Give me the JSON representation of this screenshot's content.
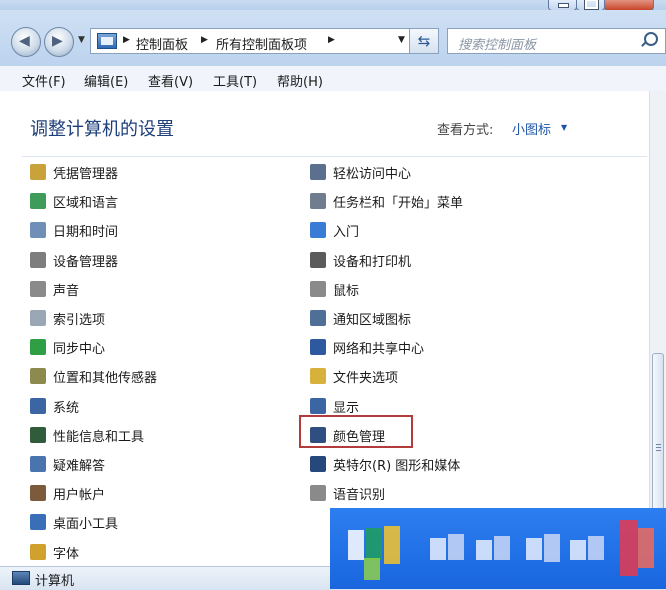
{
  "window": {
    "buttons": [
      "minimize",
      "maximize",
      "close"
    ]
  },
  "address_bar": {
    "breadcrumbs": [
      "控制面板",
      "所有控制面板项"
    ],
    "icon": "control-panel-icon"
  },
  "search": {
    "placeholder": "搜索控制面板"
  },
  "menu": [
    "文件(F)",
    "编辑(E)",
    "查看(V)",
    "工具(T)",
    "帮助(H)"
  ],
  "content": {
    "title": "调整计算机的设置",
    "view_by_label": "查看方式:",
    "view_by_value": "小图标"
  },
  "items_left": [
    {
      "label": "凭据管理器",
      "icon": "credential-icon",
      "color": "#c9a23a"
    },
    {
      "label": "区域和语言",
      "icon": "globe-icon",
      "color": "#3f9b5a"
    },
    {
      "label": "日期和时间",
      "icon": "clock-icon",
      "color": "#6f8fb8"
    },
    {
      "label": "设备管理器",
      "icon": "device-manager-icon",
      "color": "#7d7d7d"
    },
    {
      "label": "声音",
      "icon": "speaker-icon",
      "color": "#8a8a8a"
    },
    {
      "label": "索引选项",
      "icon": "index-icon",
      "color": "#9aa7b5"
    },
    {
      "label": "同步中心",
      "icon": "sync-icon",
      "color": "#2f9e44"
    },
    {
      "label": "位置和其他传感器",
      "icon": "sensor-icon",
      "color": "#8c8a4e"
    },
    {
      "label": "系统",
      "icon": "system-icon",
      "color": "#3b66a3"
    },
    {
      "label": "性能信息和工具",
      "icon": "performance-icon",
      "color": "#2f5d3b"
    },
    {
      "label": "疑难解答",
      "icon": "troubleshoot-icon",
      "color": "#4a74ad"
    },
    {
      "label": "用户帐户",
      "icon": "users-icon",
      "color": "#7d5a3c"
    },
    {
      "label": "桌面小工具",
      "icon": "gadget-icon",
      "color": "#3a6fb8"
    },
    {
      "label": "字体",
      "icon": "font-icon",
      "color": "#d1a12e"
    }
  ],
  "items_right": [
    {
      "label": "轻松访问中心",
      "icon": "ease-of-access-icon",
      "color": "#5b6f8f"
    },
    {
      "label": "任务栏和「开始」菜单",
      "icon": "taskbar-icon",
      "color": "#6f7d8f"
    },
    {
      "label": "入门",
      "icon": "getting-started-icon",
      "color": "#3a7bd5"
    },
    {
      "label": "设备和打印机",
      "icon": "printer-icon",
      "color": "#5b5b5b"
    },
    {
      "label": "鼠标",
      "icon": "mouse-icon",
      "color": "#8a8a8a"
    },
    {
      "label": "通知区域图标",
      "icon": "notification-icon",
      "color": "#4e6f96"
    },
    {
      "label": "网络和共享中心",
      "icon": "network-icon",
      "color": "#2d5a9e"
    },
    {
      "label": "文件夹选项",
      "icon": "folder-icon",
      "color": "#d8b13c"
    },
    {
      "label": "显示",
      "icon": "display-icon",
      "color": "#3b66a3"
    },
    {
      "label": "颜色管理",
      "icon": "color-management-icon",
      "color": "#2e4f7f"
    },
    {
      "label": "英特尔(R) 图形和媒体",
      "icon": "intel-graphics-icon",
      "color": "#24497a"
    },
    {
      "label": "语音识别",
      "icon": "microphone-icon",
      "color": "#8a8a8a"
    }
  ],
  "status": {
    "text": "计算机"
  }
}
